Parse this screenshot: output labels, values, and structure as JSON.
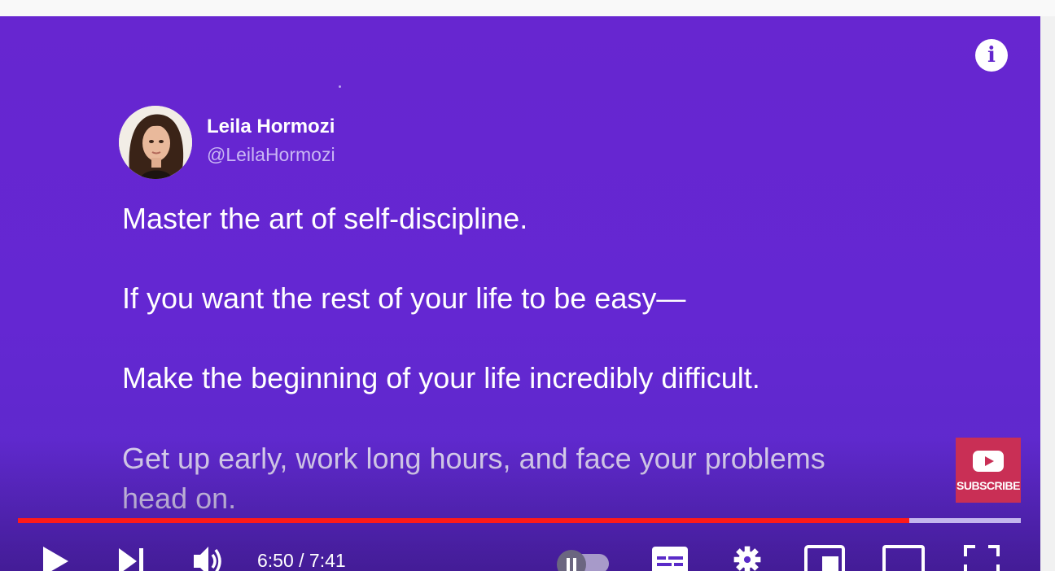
{
  "player": {
    "info_glyph": "i",
    "info_icon": "info-icon"
  },
  "tweet": {
    "author_name": "Leila Hormozi",
    "author_handle": "@LeilaHormozi",
    "lines": [
      "Master the art of self-discipline.",
      "If you want the rest of your life to be easy—",
      "Make the beginning of your life incredibly difficult.",
      "Get up early, work long hours, and face your problems",
      "head on."
    ]
  },
  "subscribe": {
    "label": "SUBSCRIBE",
    "icon": "youtube-logo-icon"
  },
  "progress": {
    "played_fraction": 0.889,
    "buffered_fraction": 1.0
  },
  "controls": {
    "time_display": "6:50 / 7:41",
    "autoplay_on": false,
    "icons": [
      "play-icon",
      "next-icon",
      "volume-icon",
      "autoplay-toggle",
      "subtitles-icon",
      "settings-icon",
      "miniplayer-icon",
      "theater-mode-icon",
      "fullscreen-icon"
    ]
  },
  "colors": {
    "background": "#6427d2",
    "progress_played": "#ff1a1a",
    "subscribe_bg": "#c92f55"
  }
}
